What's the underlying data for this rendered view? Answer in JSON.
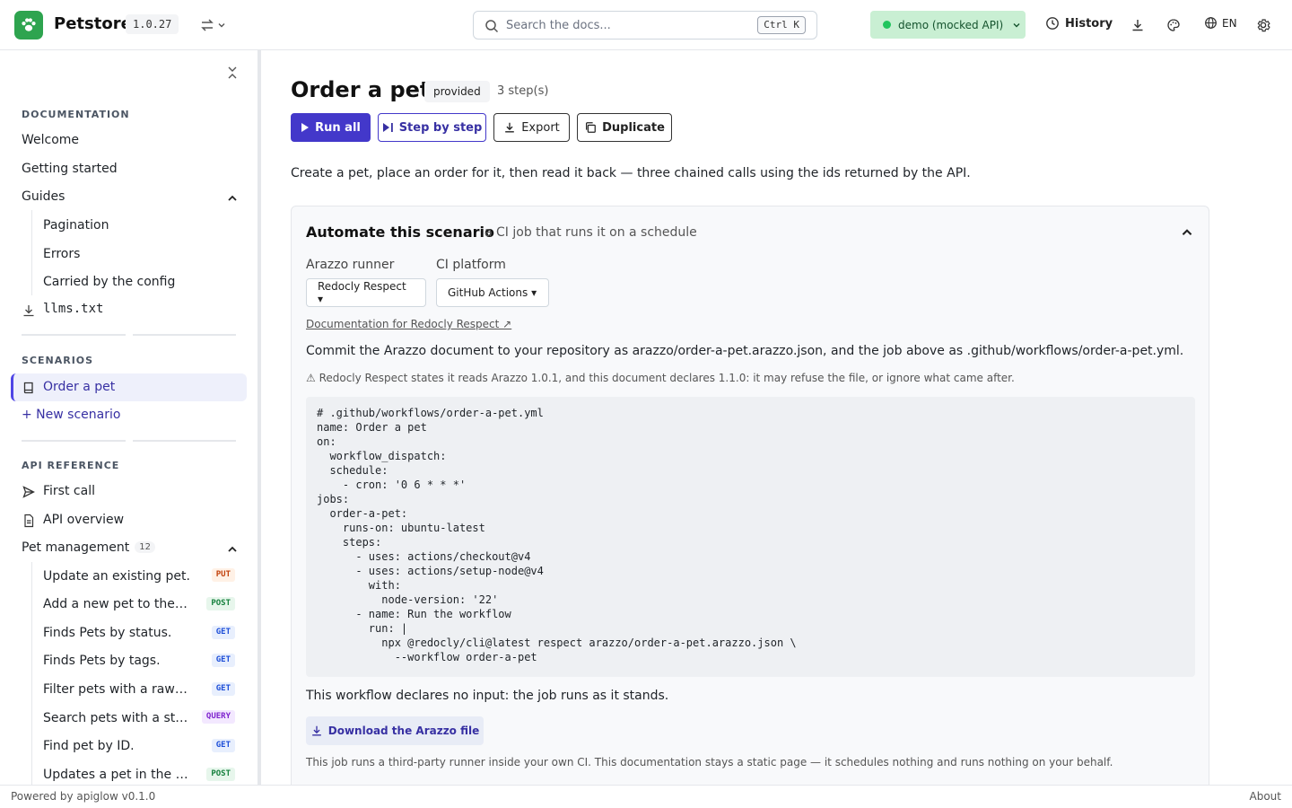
{
  "header": {
    "brand": "Petstore",
    "version": "1.0.27",
    "search_placeholder": "Search the docs...",
    "search_kbd": "Ctrl K",
    "env_label": "demo (mocked API)",
    "history_label": "History",
    "lang_label": "EN"
  },
  "sidebar": {
    "doc_heading": "DOCUMENTATION",
    "doc_items": [
      "Welcome",
      "Getting started",
      "Guides"
    ],
    "guide_items": [
      "Pagination",
      "Errors",
      "Carried by the config"
    ],
    "llms_label": "llms.txt",
    "scenarios_heading": "SCENARIOS",
    "active_scenario": "Order a pet",
    "new_scenario": "+ New scenario",
    "api_heading": "API REFERENCE",
    "first_call": "First call",
    "api_overview": "API overview",
    "pet_mgmt": "Pet management",
    "pet_mgmt_count": "12",
    "operations": [
      {
        "label": "Update an existing pet.",
        "method": "PUT"
      },
      {
        "label": "Add a new pet to the store.",
        "method": "POST"
      },
      {
        "label": "Finds Pets by status.",
        "method": "GET"
      },
      {
        "label": "Finds Pets by tags.",
        "method": "GET"
      },
      {
        "label": "Filter pets with a raw query.",
        "method": "GET"
      },
      {
        "label": "Search pets with a structured query.",
        "method": "QUERY"
      },
      {
        "label": "Find pet by ID.",
        "method": "GET"
      },
      {
        "label": "Updates a pet in the store.",
        "method": "POST"
      }
    ]
  },
  "main": {
    "title": "Order a pet",
    "provided": "provided",
    "steps": "3 step(s)",
    "run_all": "Run all",
    "step_by_step": "Step by step",
    "export": "Export",
    "duplicate": "Duplicate",
    "description": "Create a pet, place an order for it, then read it back — three chained calls using the ids returned by the API."
  },
  "automate": {
    "title": "Automate this scenario",
    "subtitle": "a CI job that runs it on a schedule",
    "runner_label": "Arazzo runner",
    "runner_value": "Redocly Respect",
    "platform_label": "CI platform",
    "platform_value": "GitHub Actions",
    "doc_link": "Documentation for Redocly Respect ↗",
    "commit_text": "Commit the Arazzo document to your repository as arazzo/order-a-pet.arazzo.json, and the job above as .github/workflows/order-a-pet.yml.",
    "warning": "⚠ Redocly Respect states it reads Arazzo 1.0.1, and this document declares 1.1.0: it may refuse the file, or ignore what came after.",
    "code": "# .github/workflows/order-a-pet.yml\nname: Order a pet\non:\n  workflow_dispatch:\n  schedule:\n    - cron: '0 6 * * *'\njobs:\n  order-a-pet:\n    runs-on: ubuntu-latest\n    steps:\n      - uses: actions/checkout@v4\n      - uses: actions/setup-node@v4\n        with:\n          node-version: '22'\n      - name: Run the workflow\n        run: |\n          npx @redocly/cli@latest respect arazzo/order-a-pet.arazzo.json \\\n            --workflow order-a-pet",
    "no_input": "This workflow declares no input: the job runs as it stands.",
    "download": "Download the Arazzo file",
    "footnote": "This job runs a third-party runner inside your own CI. This documentation stays a static page — it schedules nothing and runs nothing on your behalf."
  },
  "footer": {
    "powered": "Powered by apiglow v0.1.0",
    "about": "About"
  }
}
